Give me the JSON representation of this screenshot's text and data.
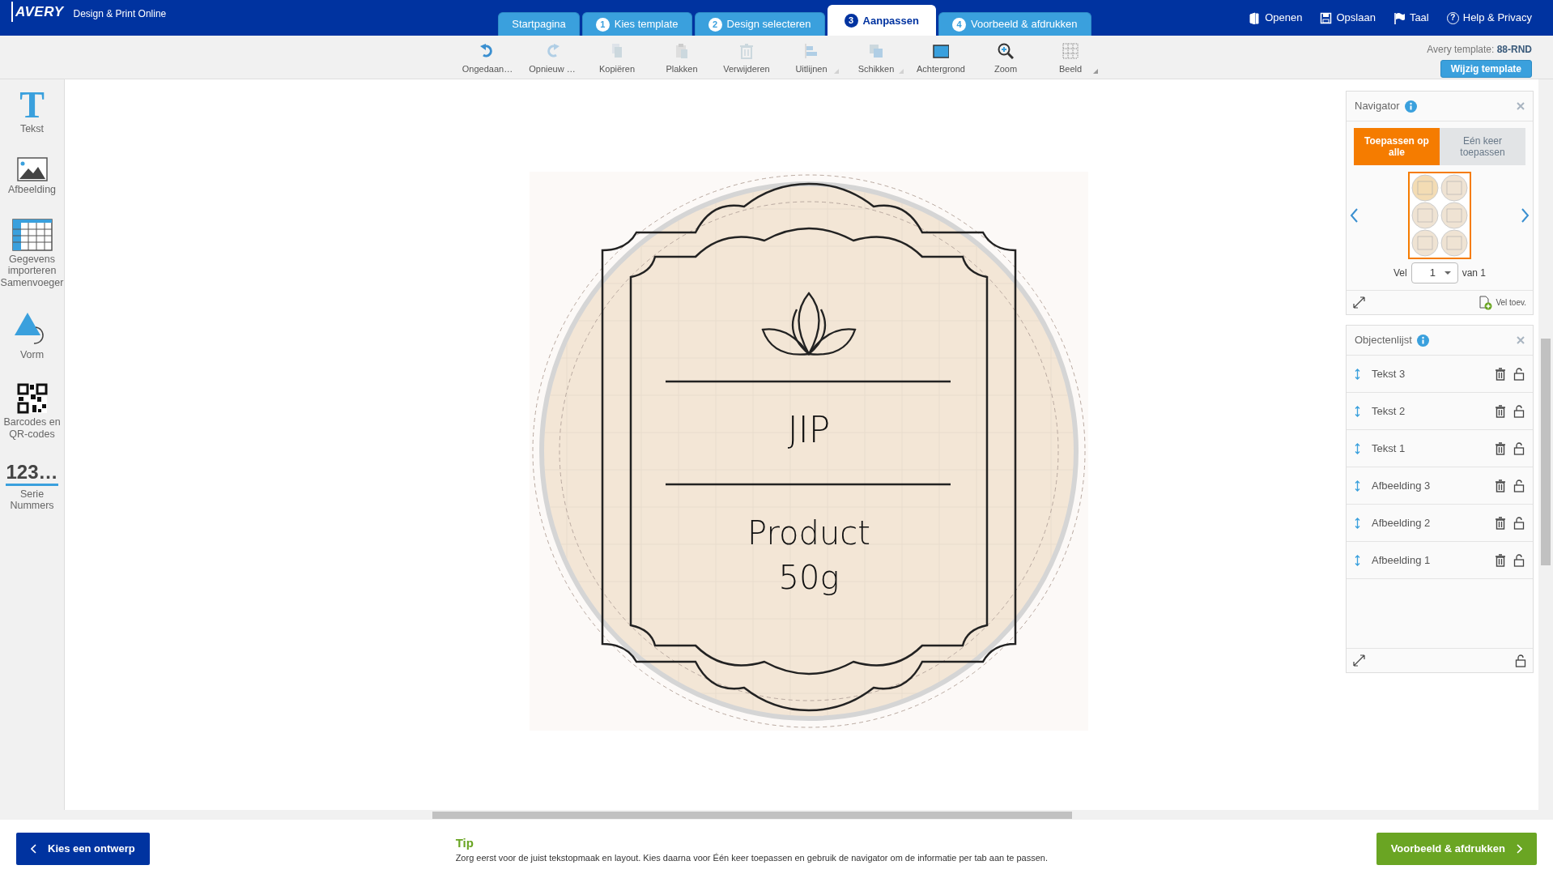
{
  "header": {
    "logo": "AVERY",
    "app_title": "Design & Print Online",
    "tabs": [
      {
        "label": "Startpagina",
        "selected": false
      },
      {
        "number": "1",
        "label": "Kies template",
        "selected": false
      },
      {
        "number": "2",
        "label": "Design selecteren",
        "selected": false
      },
      {
        "number": "3",
        "label": "Aanpassen",
        "selected": true
      },
      {
        "number": "4",
        "label": "Voorbeeld & afdrukken",
        "selected": false
      }
    ],
    "menu": [
      {
        "kind": "open",
        "label": "Openen"
      },
      {
        "kind": "save",
        "label": "Opslaan"
      },
      {
        "kind": "flag",
        "label": "Taal"
      },
      {
        "kind": "help",
        "icon_text": "?",
        "label": "Help & Privacy"
      }
    ]
  },
  "toolbar": {
    "items": [
      {
        "kind": "undo",
        "label": "Ongedaan…",
        "disabled": false,
        "has_menu": false
      },
      {
        "kind": "redo",
        "label": "Opnieuw …",
        "disabled": true,
        "has_menu": false
      },
      {
        "kind": "copy",
        "label": "Kopiëren",
        "disabled": true,
        "has_menu": false
      },
      {
        "kind": "paste",
        "label": "Plakken",
        "disabled": true,
        "has_menu": false
      },
      {
        "kind": "delete",
        "label": "Verwijderen",
        "disabled": true,
        "has_menu": false
      },
      {
        "kind": "align",
        "label": "Uitlijnen",
        "disabled": true,
        "has_menu": true
      },
      {
        "kind": "arrange",
        "label": "Schikken",
        "disabled": true,
        "has_menu": true
      },
      {
        "kind": "background",
        "label": "Achtergrond",
        "disabled": false,
        "has_menu": false
      },
      {
        "kind": "zoom",
        "label": "Zoom",
        "disabled": false,
        "has_menu": false
      },
      {
        "kind": "grid",
        "label": "Beeld",
        "disabled": false,
        "has_menu": true
      }
    ],
    "template_label": "Avery template:",
    "template_code": "88-RND",
    "change_button": "Wijzig template"
  },
  "sidebar": {
    "tools": [
      {
        "kind": "text",
        "label": "Tekst",
        "icon_text": "T"
      },
      {
        "kind": "image",
        "label": "Afbeelding"
      },
      {
        "kind": "table",
        "label": "Gegevens importeren Samenvoeger"
      },
      {
        "kind": "shape",
        "label": "Vorm"
      },
      {
        "kind": "qr",
        "label": "Barcodes en QR-codes"
      },
      {
        "kind": "serial",
        "label": "Serie Nummers",
        "icon_text": "123…"
      }
    ]
  },
  "canvas": {
    "texts": [
      {
        "kind": "title",
        "text": "JIP"
      },
      {
        "kind": "line1",
        "text": "Product"
      },
      {
        "kind": "line2",
        "text": "50g"
      }
    ]
  },
  "navigator": {
    "title": "Navigator",
    "apply_options": [
      {
        "label": "Toepassen op alle",
        "selected": true
      },
      {
        "label": "Eén keer toepassen",
        "selected": false
      }
    ],
    "sheet_label": "Vel",
    "sheet_value": "1",
    "sheet_total": "van 1",
    "add_sheet": "Vel toev."
  },
  "object_list": {
    "title": "Objectenlijst",
    "items": [
      {
        "label": "Tekst 3"
      },
      {
        "label": "Tekst 2"
      },
      {
        "label": "Tekst 1"
      },
      {
        "label": "Afbeelding 3"
      },
      {
        "label": "Afbeelding 2"
      },
      {
        "label": "Afbeelding 1"
      }
    ]
  },
  "footer": {
    "back_button": "Kies een ontwerp",
    "tip_title": "Tip",
    "tip_text": "Zorg eerst voor de juist tekstopmaak en layout. Kies daarna voor Één keer toepassen en gebruik de navigator om de informatie per tab aan te passen.",
    "next_button": "Voorbeeld & afdrukken"
  }
}
